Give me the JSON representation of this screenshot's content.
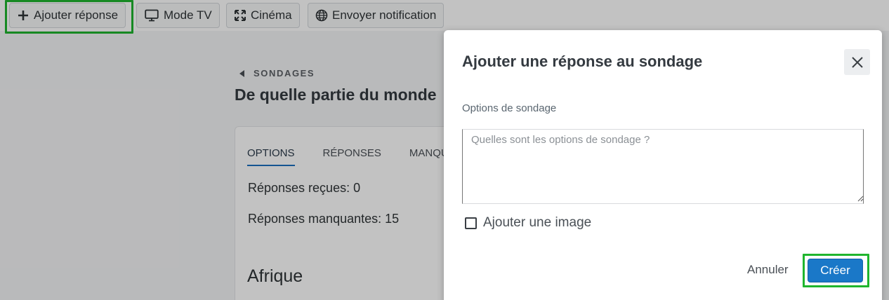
{
  "toolbar": {
    "buttons": [
      {
        "label": "Ajouter réponse",
        "icon": "plus-icon"
      },
      {
        "label": "Mode TV",
        "icon": "monitor-icon"
      },
      {
        "label": "Cinéma",
        "icon": "expand-icon"
      },
      {
        "label": "Envoyer notification",
        "icon": "globe-icon"
      }
    ]
  },
  "page": {
    "breadcrumb": "SONDAGES",
    "title": "De quelle partie du monde",
    "tabs": [
      "OPTIONS",
      "RÉPONSES",
      "MANQU"
    ],
    "received": "Réponses reçues: 0",
    "missing": "Réponses manquantes: 15",
    "region": "Afrique"
  },
  "modal": {
    "title": "Ajouter une réponse au sondage",
    "field_label": "Options de sondage",
    "placeholder": "Quelles sont les options de sondage ?",
    "checkbox_label": "Ajouter une image",
    "cancel_label": "Annuler",
    "create_label": "Créer"
  },
  "colors": {
    "highlight": "#1fb52e",
    "primary": "#1a78c8",
    "active_tab": "#1b6fbf"
  }
}
